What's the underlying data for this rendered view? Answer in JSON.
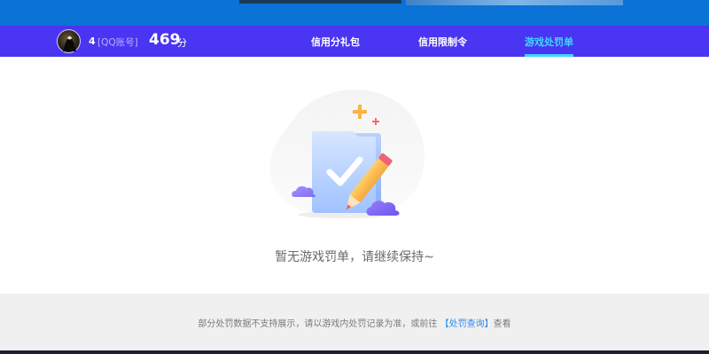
{
  "user": {
    "id": "4",
    "account_type": "[QQ账号]",
    "score": "469",
    "score_unit": "分"
  },
  "tabs": [
    {
      "label": "信用分礼包",
      "active": false
    },
    {
      "label": "信用限制令",
      "active": false
    },
    {
      "label": "游戏处罚单",
      "active": true
    }
  ],
  "empty_state": {
    "message": "暂无游戏罚单，请继续保持~"
  },
  "footer": {
    "prefix": "部分处罚数据不支持展示，请以游戏内处罚记录为准，或前往",
    "link": "【处罚查询】",
    "suffix": "查看"
  },
  "colors": {
    "navbar": "#4a35f2",
    "top_strip": "#0b72d6",
    "active_tab": "#3fd6ff",
    "link": "#2b8bf2",
    "footer_bg": "#f0f0f0"
  }
}
